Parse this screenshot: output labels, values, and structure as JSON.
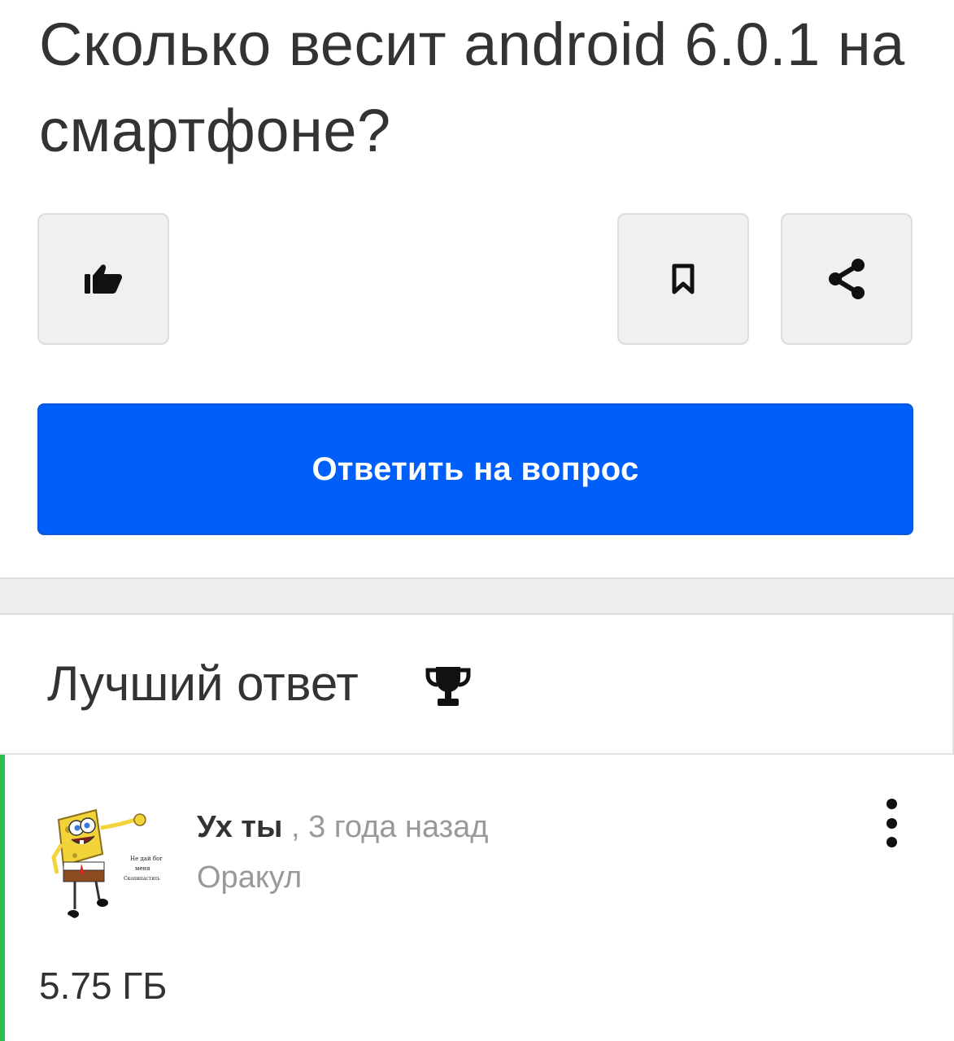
{
  "question": {
    "title": "Сколько весит android 6.0.1 на смартфоне?"
  },
  "actions": {
    "like_icon": "thumbs-up-icon",
    "bookmark_icon": "bookmark-icon",
    "share_icon": "share-icon",
    "answer_button_label": "Ответить на вопрос",
    "accent_color": "#005ff9"
  },
  "best_answer": {
    "heading": "Лучший ответ",
    "heading_icon": "trophy-icon",
    "accent_color": "#2dbe4e",
    "author": {
      "name": "Ух ты",
      "separator": " , ",
      "time": "3 года назад",
      "rank": "Оракул",
      "avatar_caption_lines": [
        "Не дай бог",
        "меня",
        "Скопипастить"
      ]
    },
    "text": "5.75 ГБ"
  }
}
